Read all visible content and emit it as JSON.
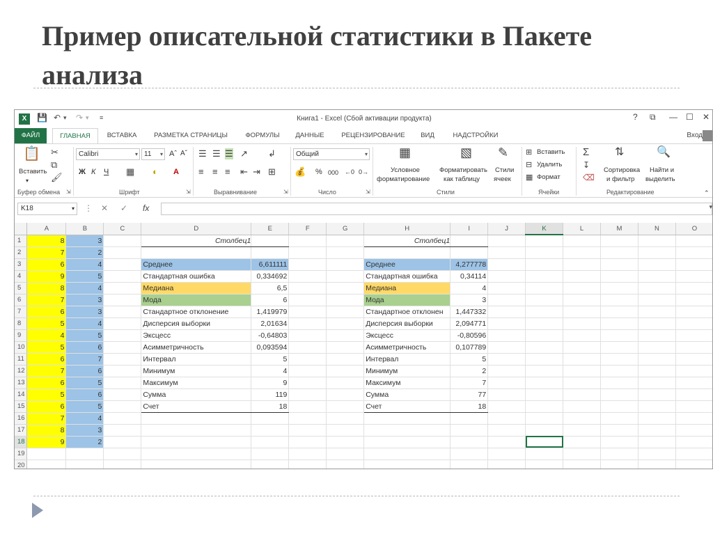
{
  "slide": {
    "title": "Пример описательной статистики в Пакете анализа"
  },
  "window": {
    "app_icon": "X",
    "title": "Книга1 - Excel (Сбой активации продукта)",
    "controls": [
      "?",
      "⧉",
      "—",
      "☐",
      "✕"
    ]
  },
  "tabs": [
    {
      "label": "ФАЙЛ"
    },
    {
      "label": "ГЛАВНАЯ"
    },
    {
      "label": "ВСТАВКА"
    },
    {
      "label": "РАЗМЕТКА СТРАНИЦЫ"
    },
    {
      "label": "ФОРМУЛЫ"
    },
    {
      "label": "ДАННЫЕ"
    },
    {
      "label": "РЕЦЕНЗИРОВАНИЕ"
    },
    {
      "label": "ВИД"
    },
    {
      "label": "НАДСТРОЙКИ"
    }
  ],
  "signin": "Вход",
  "ribbon": {
    "clipboard": {
      "paste": "Вставить",
      "label": "Буфер обмена"
    },
    "font": {
      "name": "Calibri",
      "size": "11",
      "bold": "Ж",
      "italic": "К",
      "underline": "Ч",
      "label": "Шрифт"
    },
    "alignment": {
      "label": "Выравнивание"
    },
    "number": {
      "format": "Общий",
      "percent": "%",
      "thousands": "000",
      "label": "Число"
    },
    "styles": {
      "conditional": [
        "Условное",
        "форматирование"
      ],
      "as_table": [
        "Форматировать",
        "как таблицу"
      ],
      "cell_styles": [
        "Стили",
        "ячеек"
      ],
      "label": "Стили"
    },
    "cells": {
      "insert": "Вставить",
      "delete": "Удалить",
      "format": "Формат",
      "label": "Ячейки"
    },
    "editing": {
      "sort": [
        "Сортировка",
        "и фильтр"
      ],
      "find": [
        "Найти и",
        "выделить"
      ],
      "label": "Редактирование"
    }
  },
  "formula_bar": {
    "name_box": "K18",
    "fx": "fx",
    "value": ""
  },
  "columns": [
    "A",
    "B",
    "C",
    "D",
    "E",
    "F",
    "G",
    "H",
    "I",
    "J",
    "K",
    "L",
    "M",
    "N",
    "O"
  ],
  "selected": {
    "column": "K",
    "row": 18
  },
  "col_a": [
    8,
    7,
    6,
    9,
    8,
    7,
    6,
    5,
    4,
    5,
    6,
    7,
    6,
    5,
    6,
    7,
    8,
    9
  ],
  "col_b": [
    3,
    2,
    4,
    5,
    4,
    3,
    3,
    4,
    5,
    6,
    7,
    6,
    5,
    6,
    5,
    4,
    3,
    2
  ],
  "stats_left": {
    "header": "Столбец1",
    "rows": [
      {
        "label": "Среднее",
        "value": "6,611111"
      },
      {
        "label": "Стандартная ошибка",
        "value": "0,334692"
      },
      {
        "label": "Медиана",
        "value": "6,5"
      },
      {
        "label": "Мода",
        "value": "6"
      },
      {
        "label": "Стандартное отклонение",
        "value": "1,419979"
      },
      {
        "label": "Дисперсия выборки",
        "value": "2,01634"
      },
      {
        "label": "Эксцесс",
        "value": "-0,64803"
      },
      {
        "label": "Асимметричность",
        "value": "0,093594"
      },
      {
        "label": "Интервал",
        "value": "5"
      },
      {
        "label": "Минимум",
        "value": "4"
      },
      {
        "label": "Максимум",
        "value": "9"
      },
      {
        "label": "Сумма",
        "value": "119"
      },
      {
        "label": "Счет",
        "value": "18"
      }
    ]
  },
  "stats_right": {
    "header": "Столбец1",
    "rows": [
      {
        "label": "Среднее",
        "value": "4,277778"
      },
      {
        "label": "Стандартная ошибка",
        "value": "0,34114"
      },
      {
        "label": "Медиана",
        "value": "4"
      },
      {
        "label": "Мода",
        "value": "3"
      },
      {
        "label": "Стандартное отклонен",
        "value": "1,447332"
      },
      {
        "label": "Дисперсия выборки",
        "value": "2,094771"
      },
      {
        "label": "Эксцесс",
        "value": "-0,80596"
      },
      {
        "label": "Асимметричность",
        "value": "0,107789"
      },
      {
        "label": "Интервал",
        "value": "5"
      },
      {
        "label": "Минимум",
        "value": "2"
      },
      {
        "label": "Максимум",
        "value": "7"
      },
      {
        "label": "Сумма",
        "value": "77"
      },
      {
        "label": "Счет",
        "value": "18"
      }
    ]
  },
  "colors": {
    "excel_green": "#217346",
    "yellow": "#ffff00",
    "blue": "#9dc3e6",
    "orange": "#ffd966",
    "green": "#a9d08e"
  }
}
